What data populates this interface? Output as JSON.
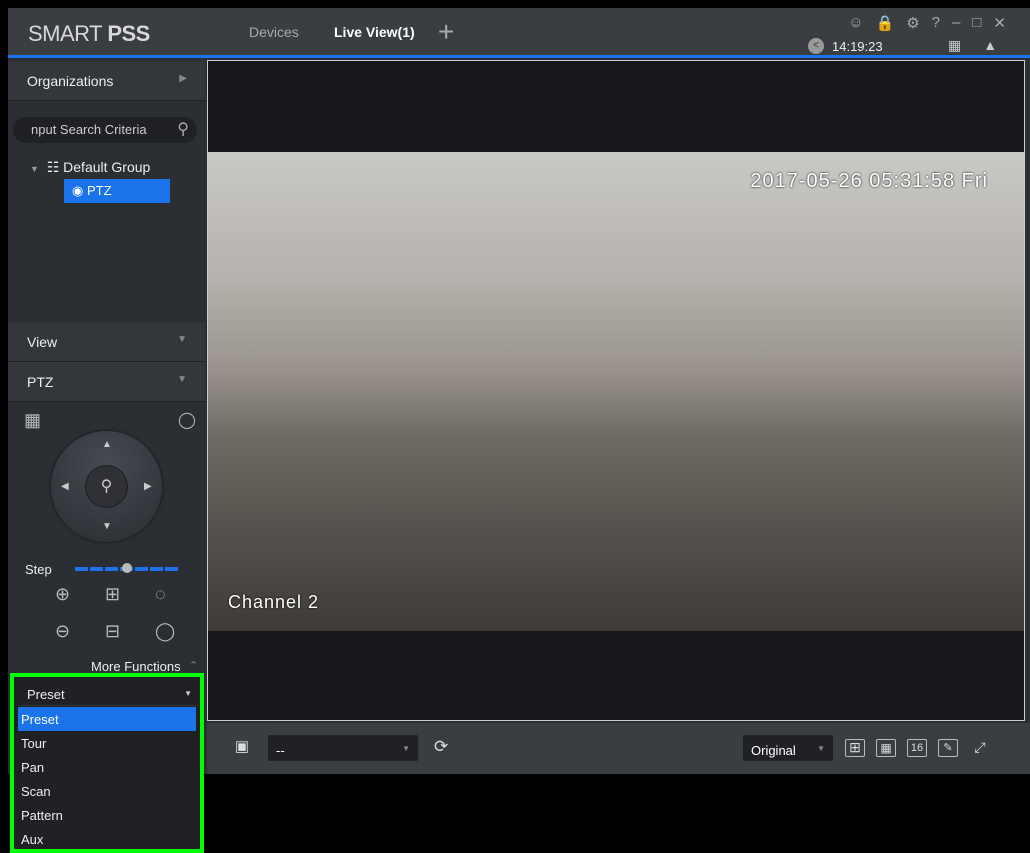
{
  "app": {
    "logo_light": "SMART ",
    "logo_bold": "PSS",
    "tabs": [
      {
        "label": "Devices"
      },
      {
        "label": "Live View(1)"
      }
    ],
    "add_tab": "+",
    "time": "14:19:23"
  },
  "sidebar": {
    "organizations": "Organizations",
    "search_placeholder": "nput Search Criteria",
    "tree": {
      "group": "Default Group",
      "device": "PTZ"
    },
    "view": "View",
    "ptz": "PTZ",
    "step_label": "Step",
    "step_value": 0.5,
    "more_functions": "More Functions"
  },
  "dropdown": {
    "selected": "Preset",
    "options": [
      "Preset",
      "Tour",
      "Pan",
      "Scan",
      "Pattern",
      "Aux"
    ]
  },
  "video": {
    "timestamp": "2017-05-26 05:31:58 Fri",
    "channel": "Channel 2"
  },
  "bottom": {
    "view_select": "--",
    "stream_select": "Original",
    "grid16": "16"
  },
  "colors": {
    "accent": "#1a73e8",
    "highlight": "#00ff00"
  }
}
